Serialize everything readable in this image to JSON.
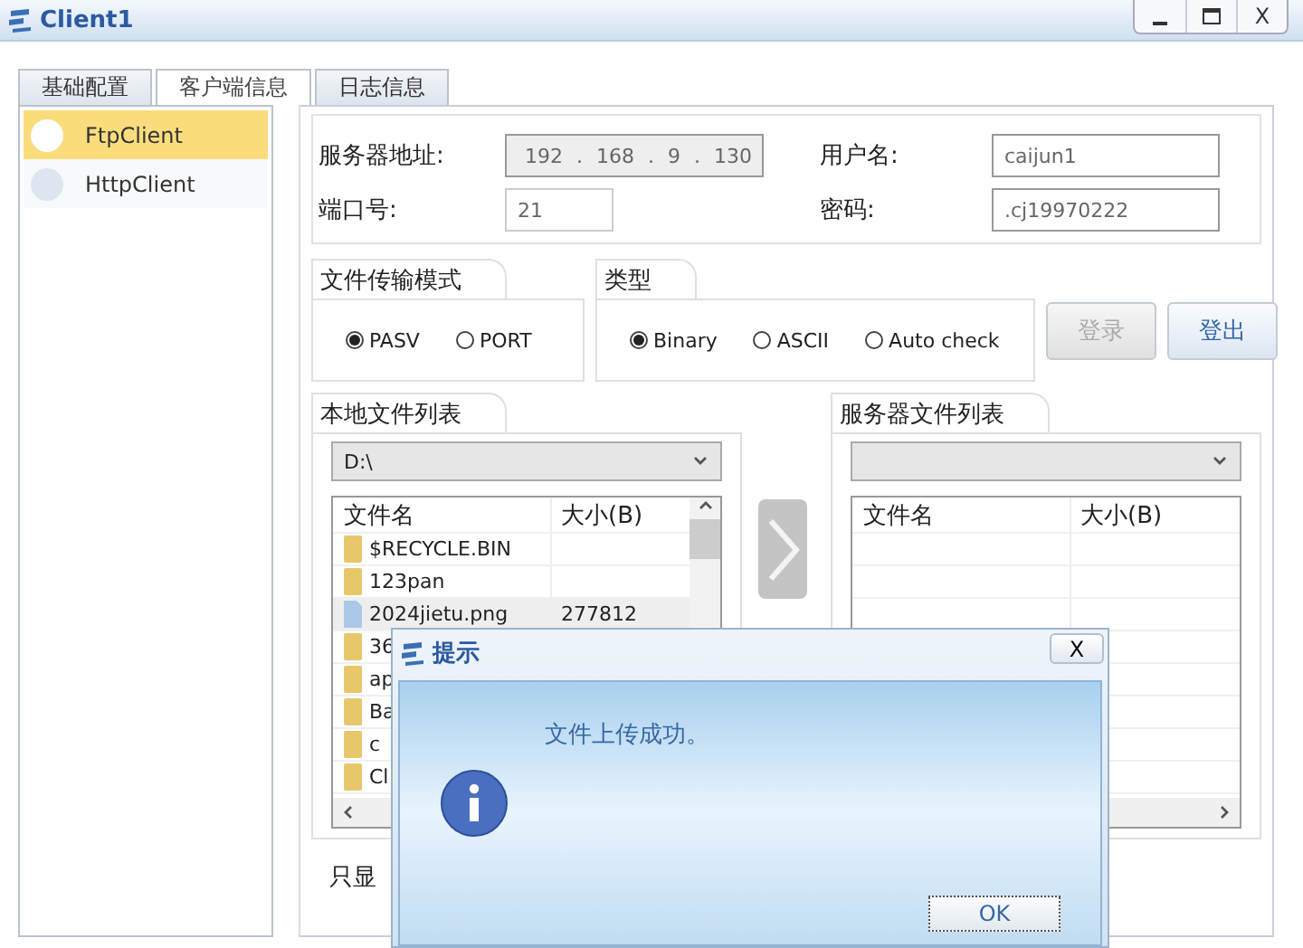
{
  "window": {
    "title": "Client1",
    "close": "X"
  },
  "tabs": [
    {
      "label": "基础配置",
      "selected": false
    },
    {
      "label": "客户端信息",
      "selected": true
    },
    {
      "label": "日志信息",
      "selected": false
    }
  ],
  "sidebar": {
    "items": [
      {
        "label": "FtpClient",
        "selected": true
      },
      {
        "label": "HttpClient",
        "selected": false
      }
    ]
  },
  "server": {
    "address_label": "服务器地址:",
    "address": "192 . 168 . 9 . 130",
    "port_label": "端口号:",
    "port": "21",
    "user_label": "用户名:",
    "user": "caijun1",
    "password_label": "密码:",
    "password": ".cj19970222"
  },
  "transfer_mode": {
    "title": "文件传输模式",
    "options": [
      {
        "label": "PASV",
        "selected": true
      },
      {
        "label": "PORT",
        "selected": false
      }
    ]
  },
  "type": {
    "title": "类型",
    "options": [
      {
        "label": "Binary",
        "selected": true
      },
      {
        "label": "ASCII",
        "selected": false
      },
      {
        "label": "Auto check",
        "selected": false
      }
    ]
  },
  "buttons": [
    {
      "label": "登录",
      "disabled": true
    },
    {
      "label": "登出",
      "disabled": false
    }
  ],
  "local_list": {
    "title": "本地文件列表",
    "drive": "D:\\",
    "columns": [
      "文件名",
      "大小(B)"
    ],
    "rows": [
      {
        "kind": "folder",
        "name": "$RECYCLE.BIN",
        "selected": false
      },
      {
        "kind": "folder",
        "name": "123pan",
        "selected": false
      },
      {
        "kind": "file",
        "name": "2024jietu.png",
        "size": "277812",
        "selected": true
      },
      {
        "kind": "folder",
        "name": "36",
        "selected": false
      },
      {
        "kind": "folder",
        "name": "ap",
        "selected": false
      },
      {
        "kind": "folder",
        "name": "Ba",
        "selected": false
      },
      {
        "kind": "folder",
        "name": "c",
        "selected": false
      },
      {
        "kind": "folder",
        "name": "Cl",
        "selected": false
      }
    ]
  },
  "server_list": {
    "title": "服务器文件列表",
    "columns": [
      "文件名",
      "大小(B)"
    ]
  },
  "filter_label": "只显",
  "dialog": {
    "title": "提示",
    "close": "X",
    "message": "文件上传成功。",
    "ok": "OK"
  }
}
